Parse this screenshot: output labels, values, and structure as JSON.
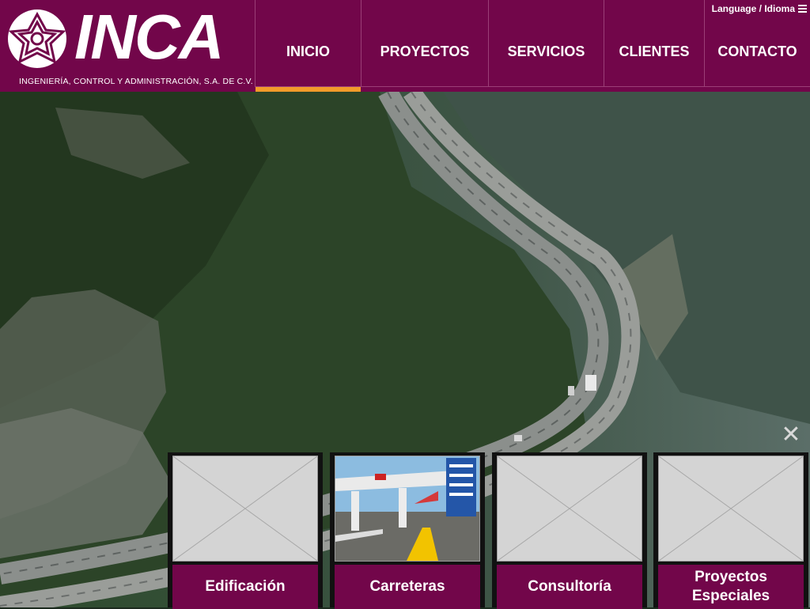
{
  "brand": {
    "name": "INCA",
    "subtitle": "INGENIERÍA, CONTROL Y ADMINISTRACIÓN, S.A. DE C.V.",
    "color": "#72064a",
    "accent": "#f29a2a"
  },
  "language": {
    "label": "Language / Idioma",
    "icon": "menu-icon"
  },
  "nav": {
    "items": [
      {
        "label": "INICIO",
        "active": true
      },
      {
        "label": "PROYECTOS",
        "active": false
      },
      {
        "label": "SERVICIOS",
        "active": false
      },
      {
        "label": "CLIENTES",
        "active": false
      },
      {
        "label": "CONTACTO",
        "active": false
      }
    ]
  },
  "hero": {
    "close_icon": "close-icon"
  },
  "cards": [
    {
      "label": "Edificación",
      "thumbnail": "placeholder"
    },
    {
      "label": "Carreteras",
      "thumbnail": "toll-booth-photo"
    },
    {
      "label": "Consultoría",
      "thumbnail": "placeholder"
    },
    {
      "label": "Proyectos Especiales",
      "thumbnail": "placeholder"
    }
  ]
}
